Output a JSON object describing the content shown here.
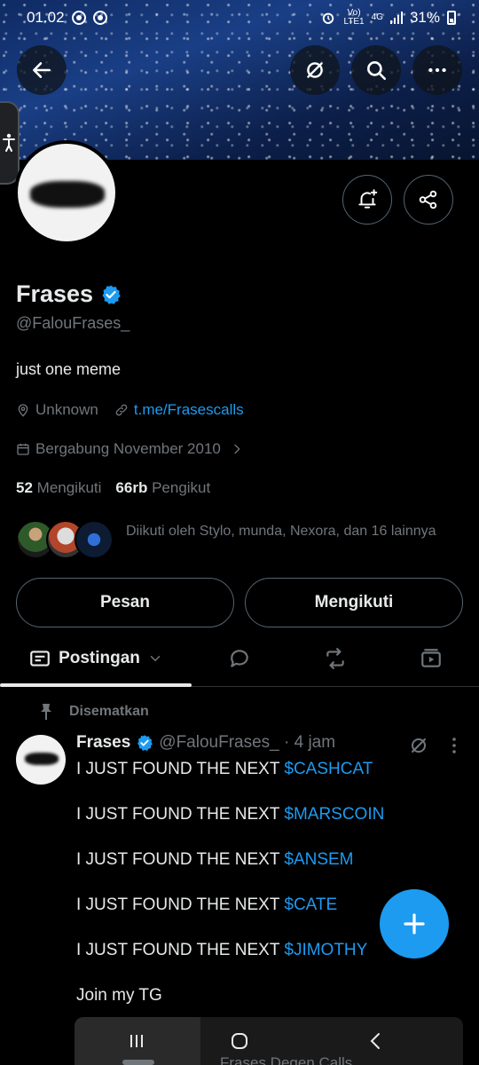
{
  "status_bar": {
    "time": "01.02",
    "network_top": "Vo)",
    "network_bottom": "LTE1",
    "signal_type": "4G",
    "battery": "31%"
  },
  "profile": {
    "display_name": "Frases",
    "handle": "@FalouFrases_",
    "bio": "just one meme",
    "location": "Unknown",
    "website": "t.me/Frasescalls",
    "joined": "Bergabung November 2010",
    "following_count": "52",
    "following_label": "Mengikuti",
    "followers_count": "66rb",
    "followers_label": "Pengikut",
    "followed_by": "Diikuti oleh Stylo, munda, Nexora, dan 16 lainnya"
  },
  "actions": {
    "message_label": "Pesan",
    "following_label": "Mengikuti"
  },
  "tabs": {
    "active_label": "Postingan"
  },
  "post": {
    "pinned_label": "Disematkan",
    "author_name": "Frases",
    "author_meta": "@FalouFrases_ · 4 jam",
    "lines": [
      {
        "prefix": "I JUST FOUND THE NEXT ",
        "tag": "$CASHCAT"
      },
      {
        "prefix": "I JUST FOUND THE NEXT ",
        "tag": "$MARSCOIN"
      },
      {
        "prefix": "I JUST FOUND THE NEXT ",
        "tag": "$ANSEM"
      },
      {
        "prefix": "I JUST FOUND THE NEXT ",
        "tag": "$CATE"
      },
      {
        "prefix": "I JUST FOUND THE NEXT ",
        "tag": "$JIMOTHY"
      }
    ],
    "footer": "Join my TG"
  },
  "peek_text": "Frases Degen Calls",
  "colors": {
    "accent": "#1d9bf0",
    "background": "#000000",
    "muted": "#71767b",
    "text": "#e7e9ea"
  },
  "icons": {
    "back": "arrow-left-icon",
    "grok": "grok-icon",
    "search": "search-icon",
    "more": "more-horizontal-icon",
    "notify": "bell-plus-icon",
    "share": "share-icon",
    "verified": "verified-badge-icon",
    "location": "location-pin-icon",
    "link": "link-icon",
    "calendar": "calendar-icon",
    "pin": "pin-icon",
    "compose": "plus-icon"
  }
}
